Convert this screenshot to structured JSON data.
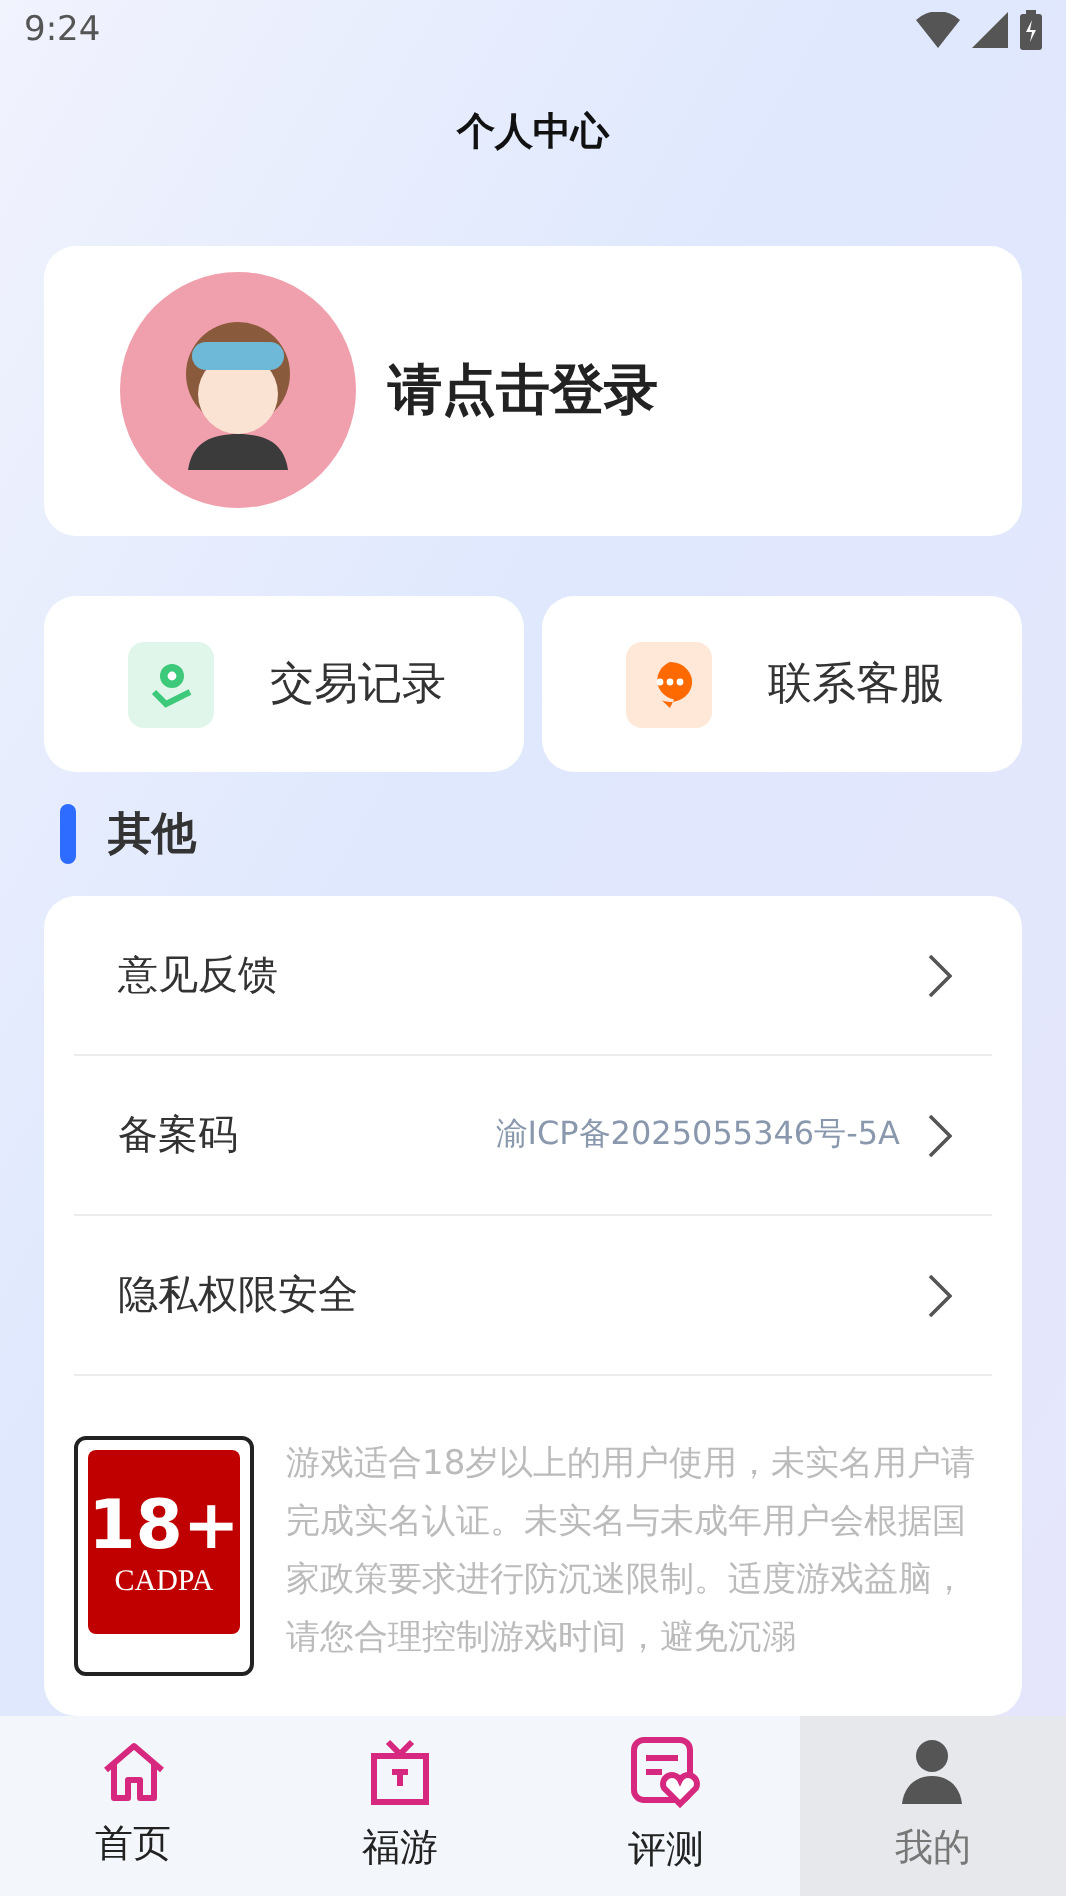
{
  "status_bar": {
    "time": "9:24"
  },
  "header": {
    "title": "个人中心"
  },
  "profile": {
    "login_prompt": "请点击登录"
  },
  "quick_actions": [
    {
      "kind": "records",
      "label": "交易记录"
    },
    {
      "kind": "service",
      "label": "联系客服"
    }
  ],
  "section": {
    "title": "其他"
  },
  "menu": [
    {
      "label": "意见反馈"
    },
    {
      "label": "备案码",
      "value": "渝ICP备2025055346号-5A"
    },
    {
      "label": "隐私权限安全"
    }
  ],
  "age_notice": {
    "badge_age": "18+",
    "badge_org": "CADPA",
    "text": "游戏适合18岁以上的用户使用，未实名用户请完成实名认证。未实名与未成年用户会根据国家政策要求进行防沉迷限制。适度游戏益脑，请您合理控制游戏时间，避免沉溺"
  },
  "tab_bar": [
    {
      "kind": "home",
      "label": "首页",
      "selected": false
    },
    {
      "kind": "gift",
      "label": "福游",
      "selected": false
    },
    {
      "kind": "review",
      "label": "评测",
      "selected": false
    },
    {
      "kind": "me",
      "label": "我的",
      "selected": true
    }
  ]
}
